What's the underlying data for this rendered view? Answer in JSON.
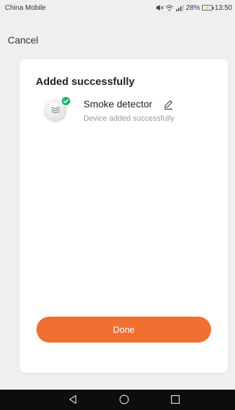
{
  "status_bar": {
    "carrier": "China Mobile",
    "signal_text": "⁴ᴳ",
    "battery_percent": "28%",
    "time": "13:50"
  },
  "header": {
    "cancel_label": "Cancel"
  },
  "card": {
    "title": "Added successfully",
    "device": {
      "name": "Smoke detector",
      "status": "Device added successfully",
      "icon": "smoke-detector-icon",
      "badge_color": "#22b573"
    },
    "done_label": "Done",
    "accent_color": "#f07031"
  },
  "nav_bar": {
    "buttons": [
      "back-icon",
      "home-icon",
      "recents-icon"
    ]
  }
}
